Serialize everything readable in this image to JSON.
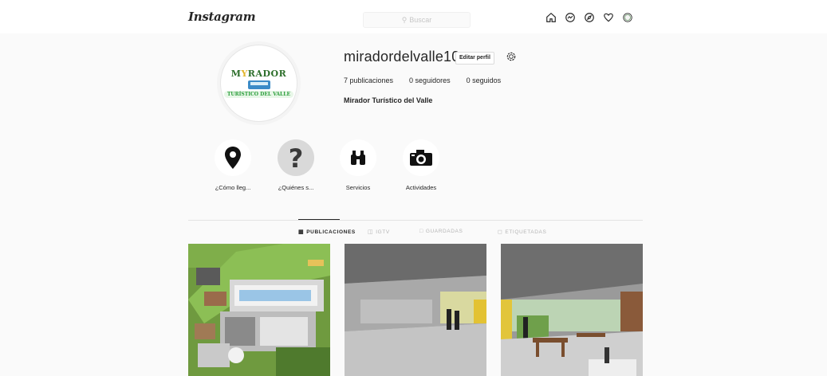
{
  "header": {
    "logo": "Instagram",
    "search_placeholder": "Buscar",
    "nav_icons": [
      "home-icon",
      "messenger-icon",
      "explore-icon",
      "heart-icon",
      "profile-icon"
    ]
  },
  "profile": {
    "username": "miradordelvalle10",
    "edit_label": "Editar perfil",
    "stats": {
      "posts": "7 publicaciones",
      "followers": "0 seguidores",
      "following": "0 seguidos"
    },
    "full_name": "Mirador Turístico del Valle",
    "avatar": {
      "title_main": "M",
      "title_y": "Y",
      "title_rest": "RADOR",
      "subtitle": "TURÍSTICO DEL VALLE"
    }
  },
  "highlights": [
    {
      "label": "¿Cómo lleg...",
      "icon": "map-pin-icon"
    },
    {
      "label": "¿Quiénes s...",
      "icon": "question-mark-icon"
    },
    {
      "label": "Servicios",
      "icon": "binoculars-icon"
    },
    {
      "label": "Actividades",
      "icon": "camera-icon"
    }
  ],
  "tabs": [
    {
      "label": "PUBLICACIONES",
      "icon": "grid-icon",
      "active": true
    },
    {
      "label": "IGTV",
      "icon": "igtv-icon",
      "active": false
    },
    {
      "label": "GUARDADAS",
      "icon": "bookmark-icon",
      "active": false
    },
    {
      "label": "ETIQUETADAS",
      "icon": "tag-icon",
      "active": false
    }
  ],
  "posts": [
    {
      "description": "aerial-site-render"
    },
    {
      "description": "interior-corridor-render"
    },
    {
      "description": "dining-terrace-render"
    }
  ],
  "colors": {
    "background": "#fafafa",
    "text": "#262626",
    "muted": "#b5b5b5",
    "accent_green": "#2c6e2a"
  }
}
